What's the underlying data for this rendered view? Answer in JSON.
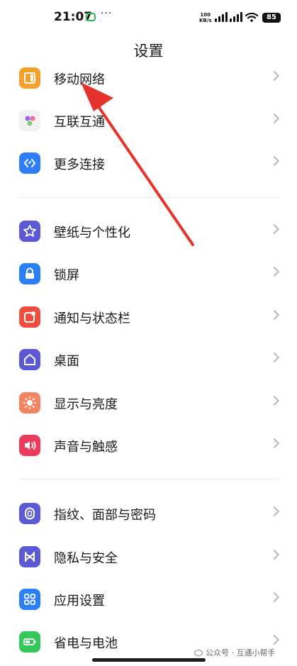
{
  "status_bar": {
    "time": "21:07",
    "dots": "···",
    "net_speed_value": "100",
    "net_speed_unit": "KB/s",
    "battery": "85"
  },
  "header": {
    "title": "设置"
  },
  "groups": [
    {
      "items": [
        {
          "label": "移动网络",
          "icon": "mobile-network-icon",
          "color": "#f5a02a"
        },
        {
          "label": "互联互通",
          "icon": "interconnect-icon",
          "color": "#f2f2f5"
        },
        {
          "label": "更多连接",
          "icon": "more-connections-icon",
          "color": "#2d7ff9"
        }
      ]
    },
    {
      "items": [
        {
          "label": "壁纸与个性化",
          "icon": "star-icon",
          "color": "#5b59d6"
        },
        {
          "label": "锁屏",
          "icon": "lock-icon",
          "color": "#2d7ff9"
        },
        {
          "label": "通知与状态栏",
          "icon": "notification-icon",
          "color": "#ef4d3f"
        },
        {
          "label": "桌面",
          "icon": "home-icon",
          "color": "#5b59d6"
        },
        {
          "label": "显示与亮度",
          "icon": "sun-icon",
          "color": "#f4845f"
        },
        {
          "label": "声音与触感",
          "icon": "speaker-icon",
          "color": "#ee3a5b"
        }
      ]
    },
    {
      "items": [
        {
          "label": "指纹、面部与密码",
          "icon": "fingerprint-icon",
          "color": "#5b59d6"
        },
        {
          "label": "隐私与安全",
          "icon": "privacy-icon",
          "color": "#5b59d6"
        },
        {
          "label": "应用设置",
          "icon": "apps-icon",
          "color": "#2d7ff9"
        },
        {
          "label": "省电与电池",
          "icon": "battery-icon",
          "color": "#34c759"
        }
      ]
    }
  ],
  "watermark": "公众号 · 互通小帮手",
  "annotation_color": "#e5322d"
}
